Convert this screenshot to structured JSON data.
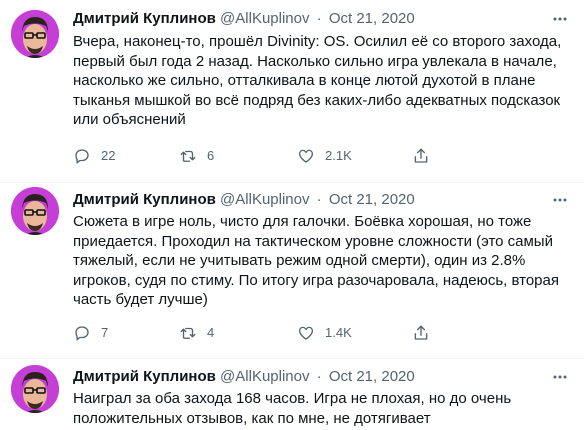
{
  "colors": {
    "avatar_bg": "#c53fd6",
    "text_primary": "#0f1419",
    "text_secondary": "#536471",
    "divider": "#eff3f4"
  },
  "tweets": [
    {
      "display_name": "Дмитрий Куплинов",
      "handle": "@AllKuplinov",
      "separator": "·",
      "date": "Oct 21, 2020",
      "text": "Вчера, наконец-то, прошёл Divinity: OS. Осилил её со второго захода,\nпервый был года 2 назад. Насколько сильно игра увлекала в начале,\nнасколько же сильно, отталкивала в конце лютой духотой в плане\nтыканья мышкой во всё подряд без каких-либо адекватных подсказок\nили объяснений",
      "replies": "22",
      "retweets": "6",
      "likes": "2.1K"
    },
    {
      "display_name": "Дмитрий Куплинов",
      "handle": "@AllKuplinov",
      "separator": "·",
      "date": "Oct 21, 2020",
      "text": "Сюжета в игре ноль, чисто для галочки. Боёвка хорошая, но тоже\nприедается. Проходил на тактическом уровне сложности (это самый\nтяжелый, если не учитывать режим одной смерти), один из 2.8%\nигроков, судя по стиму. По итогу игра разочаровала, надеюсь, вторая\nчасть будет лучше)",
      "replies": "7",
      "retweets": "4",
      "likes": "1.4K"
    },
    {
      "display_name": "Дмитрий Куплинов",
      "handle": "@AllKuplinov",
      "separator": "·",
      "date": "Oct 21, 2020",
      "text": "Наиграл за оба захода 168 часов. Игра не плохая, но до очень\nположительных отзывов, как по мне, не дотягивает"
    }
  ]
}
